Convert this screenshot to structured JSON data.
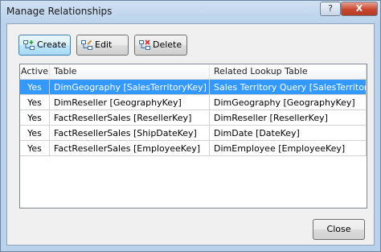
{
  "window": {
    "title": "Manage Relationships",
    "help_glyph": "?",
    "close_glyph": "X"
  },
  "toolbar": {
    "create_label": "Create",
    "edit_label": "Edit",
    "delete_label": "Delete"
  },
  "grid": {
    "columns": [
      "Active",
      "Table",
      "Related Lookup Table"
    ],
    "rows": [
      {
        "active": "Yes",
        "table": "DimGeography [SalesTerritoryKey]",
        "related": "Sales Territory Query [SalesTerritoryKey]",
        "selected": true
      },
      {
        "active": "Yes",
        "table": "DimReseller [GeographyKey]",
        "related": "DimGeography [GeographyKey]",
        "selected": false
      },
      {
        "active": "Yes",
        "table": "FactResellerSales [ResellerKey]",
        "related": "DimReseller [ResellerKey]",
        "selected": false
      },
      {
        "active": "Yes",
        "table": "FactResellerSales [ShipDateKey]",
        "related": "DimDate [DateKey]",
        "selected": false
      },
      {
        "active": "Yes",
        "table": "FactResellerSales [EmployeeKey]",
        "related": "DimEmployee [EmployeeKey]",
        "selected": false
      }
    ]
  },
  "footer": {
    "close_label": "Close"
  },
  "colors": {
    "selection": "#3399ff",
    "frame": "#b9d1ea",
    "close_button": "#c8472f"
  }
}
